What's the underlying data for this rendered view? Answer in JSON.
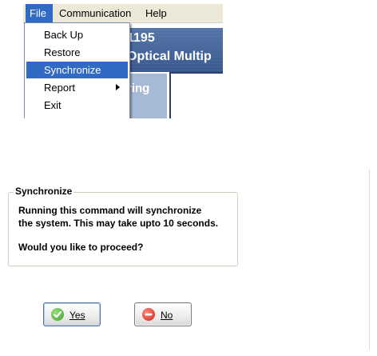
{
  "menubar": {
    "items": [
      {
        "label": "File",
        "active": true
      },
      {
        "label": "Communication",
        "active": false
      },
      {
        "label": "Help",
        "active": false
      }
    ]
  },
  "file_menu": {
    "items": [
      {
        "label": "Back Up"
      },
      {
        "label": "Restore"
      },
      {
        "label": "Synchronize",
        "highlighted": true
      },
      {
        "label": "Report",
        "has_submenu": true
      },
      {
        "label": "Exit"
      }
    ]
  },
  "app_background": {
    "banner_line1": "1195",
    "banner_line2": "Optical Multip",
    "panel_text": "ring"
  },
  "dialog": {
    "group_title": "Synchronize",
    "message_line1": "Running this command will synchronize",
    "message_line2": "the system. This may take upto 10 seconds.",
    "question": "Would you like to proceed?",
    "yes_label": "Yes",
    "no_label": "No"
  },
  "icons": {
    "yes": "check-circle-icon",
    "no": "minus-circle-icon",
    "submenu": "submenu-arrow-icon"
  },
  "colors": {
    "menu_highlight": "#316ac5",
    "yes_icon": "#3ea12c",
    "no_icon": "#d0201a",
    "banner": "#39588c"
  }
}
